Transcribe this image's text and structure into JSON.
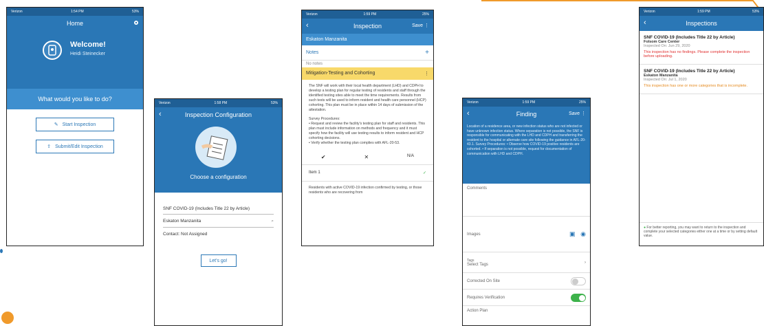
{
  "colors": {
    "primary": "#2a77b6",
    "primary_light": "#3e8fcf",
    "section_yellow": "#f8d96a",
    "toggle_green": "#3db24b",
    "warning_red": "#e03030",
    "warning_orange": "#e58a1f",
    "accent_orange": "#f09a2b"
  },
  "icons": [
    "gear-icon",
    "back-icon",
    "plus-icon",
    "more-icon",
    "search-icon",
    "camera-icon",
    "image-icon",
    "check-icon",
    "x-icon",
    "info-icon",
    "chevron-right-icon"
  ],
  "status_bar": {
    "carrier": "Verizon",
    "time1": "1:54 PM",
    "time2": "1:58 PM",
    "time3": "1:59 PM",
    "battery": "53%",
    "battery2": "25%"
  },
  "home": {
    "title": "Home",
    "welcome": "Welcome!",
    "user_name": "Heidi Steinecker",
    "question": "What would you like to do?",
    "start_button": "Start Inspection",
    "submit_button": "Submit/Edit Inspection"
  },
  "config": {
    "title": "Inspection Configuration",
    "choose": "Choose a configuration",
    "selected": "SNF COVID-19 (Includes Title 22 by Article)",
    "facility": "Eskaton Manzanita",
    "contact": "Contact:  Not Assigned",
    "go_button": "Let's go!"
  },
  "inspection": {
    "title": "Inspection",
    "save": "Save",
    "facility": "Eskaton Manzanita",
    "notes_label": "Notes",
    "no_notes": "No notes",
    "section": "Mitigation-Testing and Cohorting",
    "body1": "The SNF will work with their local health department (LHD) and CDPH to develop a testing plan for regular testing of residents and staff through the identified testing sites able to meet the time requirements. Results from such tests will be used to inform resident and health care personnel (HCP) cohorting. This plan must be in place within 14 days of submission of the attestation.",
    "survey_label": "Survey Procedures:",
    "body2": "•    Request and review the facility's testing plan for staff and residents. This plan must include information on methods and frequency and it must specify how the facility will use testing results to inform resident and HCP cohorting decisions.",
    "body3": "•    Verify whether the testing plan complies with AFL-20-53.",
    "choice_check": "✔",
    "choice_x": "✕",
    "choice_na": "N/A",
    "item": "Item 1",
    "next": "Residents with active COVID-19 infection confirmed by testing, or those residents who are recovering from"
  },
  "finding": {
    "title": "Finding",
    "save": "Save",
    "blue_text": "Location of a residence area, or new infection status who are not infected or have unknown infection status. Where separation is not possible, the SNF is responsible for communicating with the LHD and CDPH and transferring the resident to the hospital or alternate care site following the guidance in AFL-20-43.1. Survey Procedures: • Observe how COVID-19 positive residents are cohorted. • If separation is not possible, request for documentation of communication with LHD and CDPH.",
    "comments": "Comments",
    "images": "Images",
    "tags_label": "Tags",
    "tags_value": "Select Tags",
    "corrected": "Corrected On Site",
    "requires": "Requires Verification",
    "action": "Action Plan"
  },
  "inspections": {
    "title": "Inspections",
    "items": [
      {
        "title": "SNF COVID-19 (Includes Title 22 by Article)",
        "facility": "Folsom Care Center",
        "date": "Inspected On: Jun 29, 2020",
        "warning": "This inspection has no findings. Please complete the inspection before uploading."
      },
      {
        "title": "SNF COVID-19 (Includes Title 22 by Article)",
        "facility": "Eskaton Manzanita",
        "date": "Inspected On: Jul 1, 2020",
        "warning": "This inspection has one or more categories that is incomplete."
      }
    ],
    "footer": "For better reporting, you may want to return to the inspection and complete your selected categories either one at a time or by setting default value."
  }
}
